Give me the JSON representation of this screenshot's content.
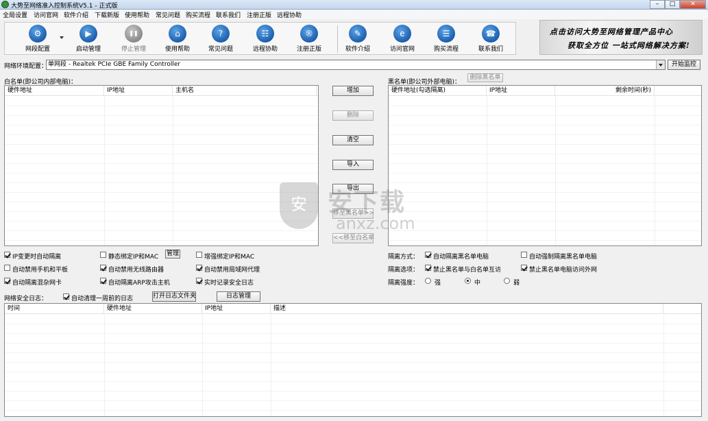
{
  "window": {
    "title": "大势至网络准入控制系统V5.1 - 正式版",
    "minimize": "–",
    "maximize": "□",
    "close": "✕"
  },
  "menu": [
    "全局设置",
    "访问官网",
    "软件介绍",
    "下载新版",
    "使用帮助",
    "常见问题",
    "购买流程",
    "联系我们",
    "注册正版",
    "远程协助"
  ],
  "toolbar": [
    {
      "label": "网段配置",
      "icon": "gear-icon",
      "glyph": "⚙"
    },
    {
      "label": "启动管理",
      "icon": "play-icon",
      "glyph": "▶"
    },
    {
      "label": "停止管理",
      "icon": "pause-icon",
      "glyph": "❚❚",
      "disabled": true
    },
    {
      "label": "使用帮助",
      "icon": "graduation-cap-icon",
      "glyph": "⌂"
    },
    {
      "label": "常见问题",
      "icon": "question-icon",
      "glyph": "?"
    },
    {
      "label": "远程协助",
      "icon": "remote-icon",
      "glyph": "☷"
    },
    {
      "label": "注册正版",
      "icon": "registered-icon",
      "glyph": "®"
    },
    {
      "label": "软件介绍",
      "icon": "edit-icon",
      "glyph": "✎"
    },
    {
      "label": "访问官网",
      "icon": "browser-icon",
      "glyph": "e"
    },
    {
      "label": "购买流程",
      "icon": "cart-icon",
      "glyph": "☰"
    },
    {
      "label": "联系我们",
      "icon": "phone-icon",
      "glyph": "☎"
    }
  ],
  "banner": {
    "line1": "点击访问大势至网络管理产品中心",
    "line2": "获取全方位 一站式网络解决方案!"
  },
  "network": {
    "label": "网络环境配置：",
    "value": "单网段 - Realtek PCIe GBE Family Controller",
    "start_button": "开始监控"
  },
  "whitelist": {
    "title": "白名单(即公司内部电脑)：",
    "columns": [
      "硬件地址",
      "IP地址",
      "主机名"
    ]
  },
  "blacklist": {
    "title": "黑名单(即公司外部电脑)：",
    "delete_button": "删除黑名单",
    "columns": [
      "硬件地址(勾选隔离)",
      "IP地址",
      "剩余时间(秒)"
    ]
  },
  "middle_buttons": {
    "add": "增加",
    "delete": "删除",
    "clear": "清空",
    "import": "导入",
    "export": "导出",
    "move_black": "移至黑名单>>",
    "move_white": "<<移至白名单"
  },
  "options": {
    "ip_change": "IP变更时自动隔离",
    "static_bind": "静态绑定IP和MAC",
    "manage": "管理",
    "enhanced_bind": "增强绑定IP和MAC",
    "block_mobile": "自动禁用手机和平板",
    "block_wireless": "自动禁用无线路由器",
    "block_proxy": "自动禁用局域网代理",
    "isolate_promisc": "自动隔离混杂网卡",
    "isolate_arp": "自动隔离ARP攻击主机",
    "log_realtime": "实时记录安全日志"
  },
  "isolation": {
    "mode_label": "隔离方式：",
    "mode_auto": "自动隔离黑名单电脑",
    "mode_force": "自动强制隔离黑名单电脑",
    "opt_label": "隔离选项：",
    "opt_no_mutual": "禁止黑名单与白名单互访",
    "opt_no_internet": "禁止黑名单电脑访问外网",
    "strength_label": "隔离强度：",
    "strength_options": [
      "强",
      "中",
      "弱"
    ],
    "strength_selected": "中"
  },
  "log": {
    "label": "网络安全日志：",
    "auto_clear": "自动清理一周前的日志",
    "open_folder": "打开日志文件夹",
    "manage": "日志管理",
    "columns": [
      "时间",
      "硬件地址",
      "IP地址",
      "描述"
    ]
  },
  "watermark": {
    "text1": "安下载",
    "text2": "anxz.com",
    "shield": "安"
  }
}
